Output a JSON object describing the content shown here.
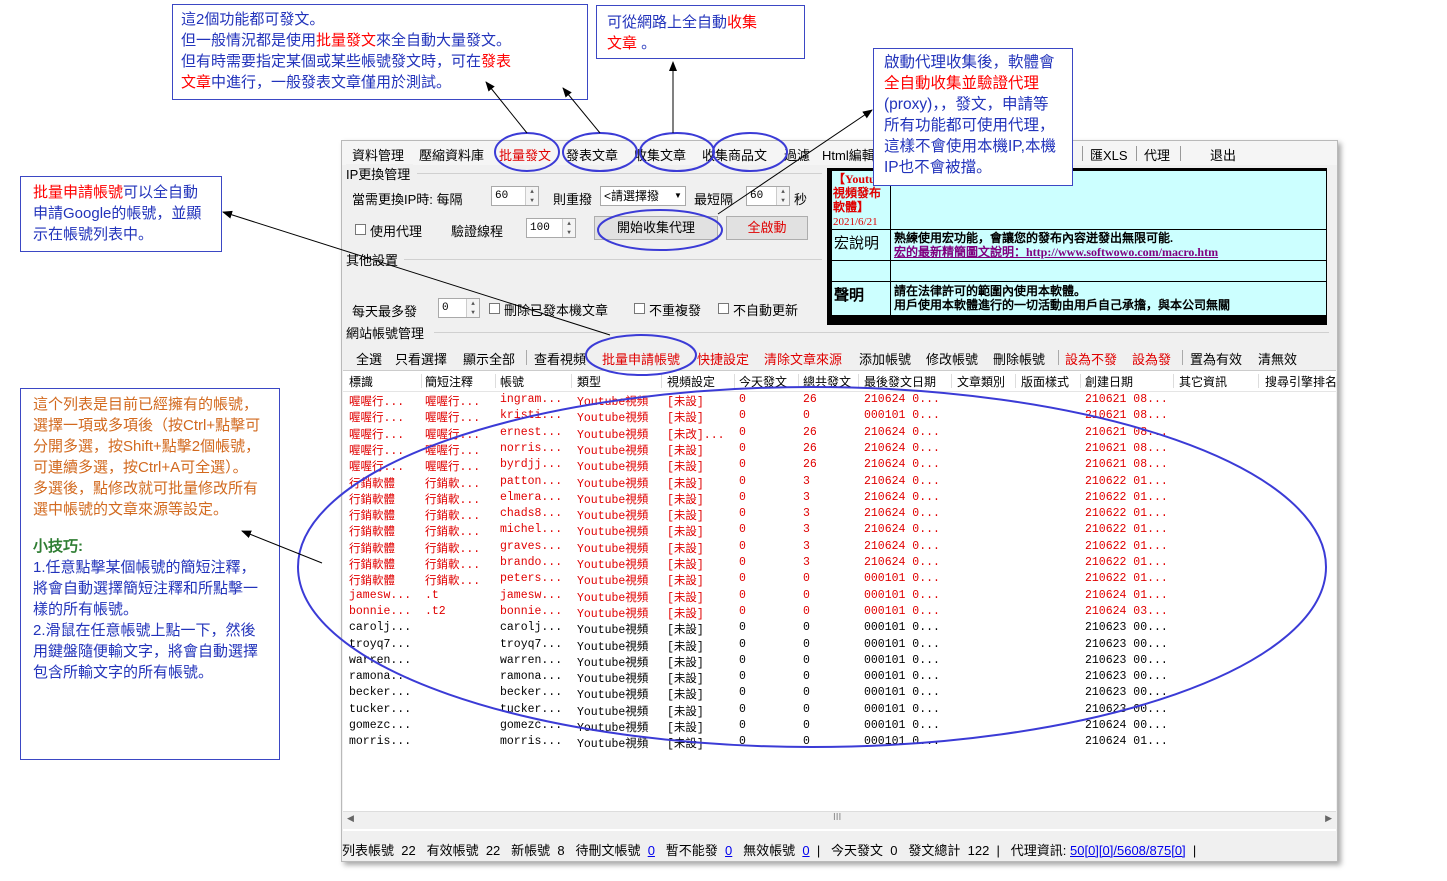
{
  "menu": [
    "資料管理",
    "壓縮資料庫",
    "批量發文",
    "發表文章",
    "收集文章",
    "收集商品文",
    "過濾",
    "Html編輯",
    "匯XLS",
    "代理",
    "退出"
  ],
  "ip_group": {
    "title": "IP更換管理",
    "need_change_ip": "當需更換IP時: 每隔",
    "every_value": "60",
    "then_redial": "則重撥",
    "select_placeholder": "<請選擇撥",
    "max_interval": "最短隔",
    "max_value": "60",
    "seconds": "秒",
    "use_proxy": "使用代理",
    "verify_threads": "驗證線程",
    "threads_value": "100",
    "start_collect_proxy": "開始收集代理",
    "start_all": "全啟動"
  },
  "other_group": {
    "title": "其他設置",
    "daily_max": "每天最多發",
    "daily_value": "0",
    "delete_posted": "刪除已發本機文章",
    "no_repeat": "不重複發",
    "no_auto_update": "不自動更新"
  },
  "info_panel": {
    "ad_title": "【Youtube視頻發布軟體】",
    "ad_date": "2021/6/21",
    "macro_label": "宏說明",
    "macro_text": "熟練使用宏功能，會讓您的發布內容迸發出無限可能.",
    "macro_link": "宏的最新精簡圖文說明：http://www.softwowo.com/macro.htm",
    "statement_label": "聲明",
    "statement_text1": "請在法律許可的範圍內使用本軟體。",
    "statement_text2": "用戶使用本軟體進行的一切活動由用戶自己承擔，與本公司無關"
  },
  "account_group_title": "網站帳號管理",
  "toolbar": [
    {
      "label": "全選",
      "color": "#000000"
    },
    {
      "label": "只看選擇",
      "color": "#000000"
    },
    {
      "label": "顯示全部",
      "color": "#000000"
    },
    {
      "label": "查看視頻",
      "color": "#000000"
    },
    {
      "label": "批量申請帳號",
      "color": "#e00000"
    },
    {
      "label": "快捷設定",
      "color": "#e00000"
    },
    {
      "label": "清除文章來源",
      "color": "#e00000"
    },
    {
      "label": "添加帳號",
      "color": "#000000"
    },
    {
      "label": "修改帳號",
      "color": "#000000"
    },
    {
      "label": "刪除帳號",
      "color": "#000000"
    },
    {
      "label": "設為不發",
      "color": "#e00000"
    },
    {
      "label": "設為發",
      "color": "#e00000"
    },
    {
      "label": "置為有效",
      "color": "#000000"
    },
    {
      "label": "清無效",
      "color": "#000000"
    }
  ],
  "columns": [
    "標識",
    "簡短注釋",
    "帳號",
    "類型",
    "視頻設定",
    "今天發文",
    "總共發文",
    "最後發文日期",
    "文章類別",
    "版面樣式",
    "創建日期",
    "其它資訊",
    "搜尋引擎排名"
  ],
  "rows": [
    {
      "c": [
        "喔喔行...",
        "喔喔行...",
        "ingram...",
        "Youtube視頻",
        "[未設]",
        "0",
        "26",
        "210624 0...",
        "",
        "",
        "210621 08..."
      ],
      "red": true
    },
    {
      "c": [
        "喔喔行...",
        "喔喔行...",
        "kristi...",
        "Youtube視頻",
        "[未設]",
        "0",
        "0",
        "000101 0...",
        "",
        "",
        "210621 08..."
      ],
      "red": true
    },
    {
      "c": [
        "喔喔行...",
        "喔喔行...",
        "ernest...",
        "Youtube視頻",
        "[未改]...",
        "0",
        "26",
        "210624 0...",
        "",
        "",
        "210621 08..."
      ],
      "red": true
    },
    {
      "c": [
        "喔喔行...",
        "喔喔行...",
        "norris...",
        "Youtube視頻",
        "[未設]",
        "0",
        "26",
        "210624 0...",
        "",
        "",
        "210621 08..."
      ],
      "red": true
    },
    {
      "c": [
        "喔喔行...",
        "喔喔行...",
        "byrdjj...",
        "Youtube視頻",
        "[未設]",
        "0",
        "26",
        "210624 0...",
        "",
        "",
        "210621 08..."
      ],
      "red": true
    },
    {
      "c": [
        "行銷軟體",
        "行銷軟...",
        "patton...",
        "Youtube視頻",
        "[未設]",
        "0",
        "3",
        "210624 0...",
        "",
        "",
        "210622 01..."
      ],
      "red": true
    },
    {
      "c": [
        "行銷軟體",
        "行銷軟...",
        "elmera...",
        "Youtube視頻",
        "[未設]",
        "0",
        "3",
        "210624 0...",
        "",
        "",
        "210622 01..."
      ],
      "red": true
    },
    {
      "c": [
        "行銷軟體",
        "行銷軟...",
        "chads8...",
        "Youtube視頻",
        "[未設]",
        "0",
        "3",
        "210624 0...",
        "",
        "",
        "210622 01..."
      ],
      "red": true
    },
    {
      "c": [
        "行銷軟體",
        "行銷軟...",
        "michel...",
        "Youtube視頻",
        "[未設]",
        "0",
        "3",
        "210624 0...",
        "",
        "",
        "210622 01..."
      ],
      "red": true
    },
    {
      "c": [
        "行銷軟體",
        "行銷軟...",
        "graves...",
        "Youtube視頻",
        "[未設]",
        "0",
        "3",
        "210624 0...",
        "",
        "",
        "210622 01..."
      ],
      "red": true
    },
    {
      "c": [
        "行銷軟體",
        "行銷軟...",
        "brando...",
        "Youtube視頻",
        "[未設]",
        "0",
        "3",
        "210624 0...",
        "",
        "",
        "210622 01..."
      ],
      "red": true
    },
    {
      "c": [
        "行銷軟體",
        "行銷軟...",
        "peters...",
        "Youtube視頻",
        "[未設]",
        "0",
        "0",
        "000101 0...",
        "",
        "",
        "210622 01..."
      ],
      "red": true
    },
    {
      "c": [
        "jamesw...",
        ".t",
        "jamesw...",
        "Youtube視頻",
        "[未設]",
        "0",
        "0",
        "000101 0...",
        "",
        "",
        "210624 01..."
      ],
      "red": true
    },
    {
      "c": [
        "bonnie...",
        ".t2",
        "bonnie...",
        "Youtube視頻",
        "[未設]",
        "0",
        "0",
        "000101 0...",
        "",
        "",
        "210624 03..."
      ],
      "red": true
    },
    {
      "c": [
        "carolj...",
        "",
        "carolj...",
        "Youtube視頻",
        "[未設]",
        "0",
        "0",
        "000101 0...",
        "",
        "",
        "210623 00..."
      ],
      "red": false
    },
    {
      "c": [
        "troyq7...",
        "",
        "troyq7...",
        "Youtube視頻",
        "[未設]",
        "0",
        "0",
        "000101 0...",
        "",
        "",
        "210623 00..."
      ],
      "red": false
    },
    {
      "c": [
        "warren...",
        "",
        "warren...",
        "Youtube視頻",
        "[未設]",
        "0",
        "0",
        "000101 0...",
        "",
        "",
        "210623 00..."
      ],
      "red": false
    },
    {
      "c": [
        "ramona...",
        "",
        "ramona...",
        "Youtube視頻",
        "[未設]",
        "0",
        "0",
        "000101 0...",
        "",
        "",
        "210623 00..."
      ],
      "red": false
    },
    {
      "c": [
        "becker...",
        "",
        "becker...",
        "Youtube視頻",
        "[未設]",
        "0",
        "0",
        "000101 0...",
        "",
        "",
        "210623 00..."
      ],
      "red": false
    },
    {
      "c": [
        "tucker...",
        "",
        "tucker...",
        "Youtube視頻",
        "[未設]",
        "0",
        "0",
        "000101 0...",
        "",
        "",
        "210623 00..."
      ],
      "red": false
    },
    {
      "c": [
        "gomezc...",
        "",
        "gomezc...",
        "Youtube視頻",
        "[未設]",
        "0",
        "0",
        "000101 0...",
        "",
        "",
        "210624 00..."
      ],
      "red": false
    },
    {
      "c": [
        "morris...",
        "",
        "morris...",
        "Youtube視頻",
        "[未設]",
        "0",
        "0",
        "000101 0...",
        "",
        "",
        "210624 01..."
      ],
      "red": false
    }
  ],
  "status": {
    "list_accounts_label": "列表帳號",
    "list_accounts": "22",
    "valid_label": "有效帳號",
    "valid": "22",
    "new_label": "新帳號",
    "new": "8",
    "pending_delete_label": "待刪文帳號",
    "pending_delete": "0",
    "cannot_post_label": "暫不能發",
    "cannot_post": "0",
    "invalid_label": "無效帳號",
    "invalid": "0",
    "today_label": "今天發文",
    "today": "0",
    "total_label": "發文總計",
    "total": "122",
    "proxy_label": "代理資訊:",
    "proxy": "50[0][0]/5608/875[0]"
  },
  "notes": {
    "n1_l1": "這2個功能都可發文。",
    "n1_l2a": "但一般情況都是使用",
    "n1_l2b": "批量發文",
    "n1_l2c": "來全自動大量發文。",
    "n1_l3a": "但有時需要指定某個或某些帳號發文時，可在",
    "n1_l3b": "發表",
    "n1_l4a": "文章",
    "n1_l4b": "中進行，一般發表文章僅用於測試。",
    "n2_a": "可從網路上全自動",
    "n2_b": "收集",
    "n2_c": "文章",
    "n3_a": "啟動代理收集後，軟體會",
    "n3_b": "全自動收集並驗證代理",
    "n3_c": "(proxy)，，發文，申請等所有功能都可使用代理，這樣不會使用本機IP,本機IP也不會被擋。",
    "n4_a": "批量申請帳號",
    "n4_b": "可以全自動申請Google的帳號，並顯示在帳號列表中。",
    "n5_p1": "這个列表是目前已經擁有的帳號，選擇一項或多項後（按Ctrl+點擊可分開多選，按Shift+點擊2個帳號，可連續多選，按Ctrl+A可全選）。",
    "n5_p2": "多選後，點修改就可批量修改所有選中帳號的文章來源等設定。",
    "n5_tip": "小技巧:",
    "n5_t1": "1.任意點擊某個帳號的簡短注釋，將會自動選擇簡短注釋和所點擊一樣的所有帳號。",
    "n5_t2": "2.滑鼠在任意帳號上點一下，然後用鍵盤隨便輸文字，將會自動選擇包含所輸文字的所有帳號。"
  },
  "colors": {
    "accent_red": "#e00000",
    "annotation_blue": "#3b47c4",
    "info_bg": "#ccffff"
  }
}
